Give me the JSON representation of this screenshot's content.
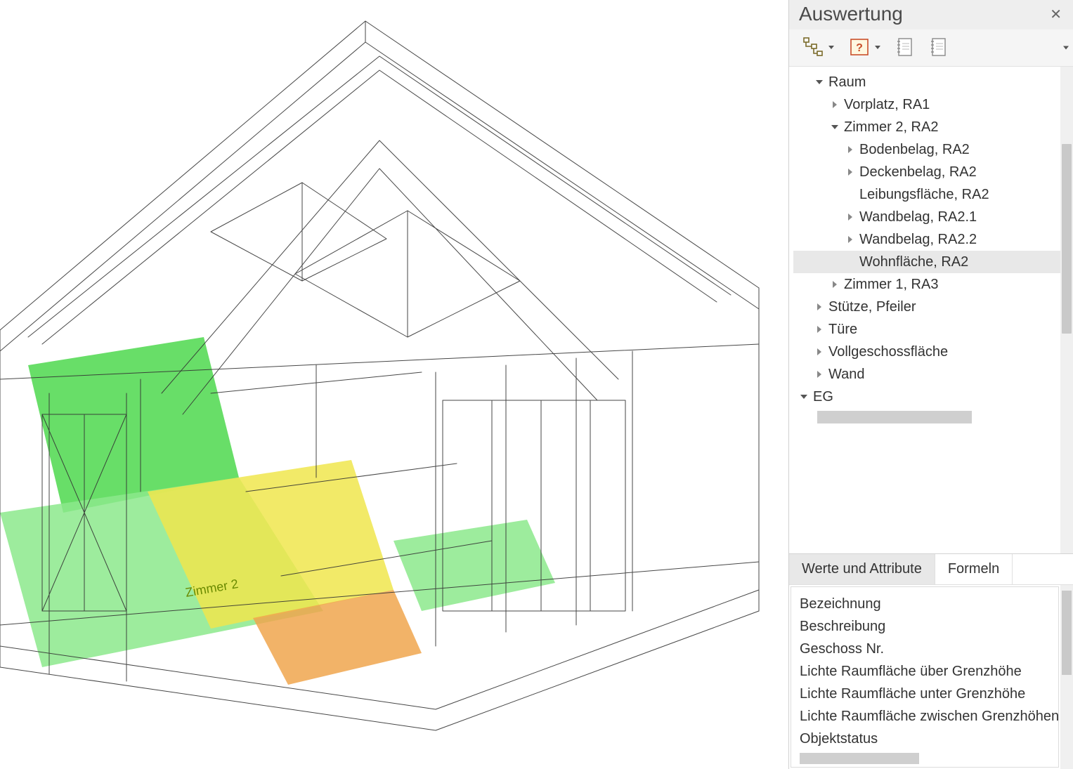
{
  "panel": {
    "title": "Auswertung",
    "tabs": {
      "values": "Werte und Attribute",
      "formulas": "Formeln"
    }
  },
  "toolbar": {
    "tree_icon": "tree-view-icon",
    "unknown_icon": "unknown-box-icon",
    "book1_icon": "notebook-icon",
    "book2_icon": "notebook-icon"
  },
  "tree": [
    {
      "indent": 1,
      "exp": "down",
      "label": "Raum"
    },
    {
      "indent": 2,
      "exp": "right",
      "label": "Vorplatz, RA1"
    },
    {
      "indent": 2,
      "exp": "down",
      "label": "Zimmer 2, RA2"
    },
    {
      "indent": 3,
      "exp": "right",
      "label": "Bodenbelag, RA2"
    },
    {
      "indent": 3,
      "exp": "right",
      "label": "Deckenbelag, RA2"
    },
    {
      "indent": 3,
      "exp": "none",
      "label": "Leibungsfläche, RA2"
    },
    {
      "indent": 3,
      "exp": "right",
      "label": "Wandbelag, RA2.1"
    },
    {
      "indent": 3,
      "exp": "right",
      "label": "Wandbelag, RA2.2"
    },
    {
      "indent": 3,
      "exp": "none",
      "label": "Wohnfläche, RA2",
      "selected": true
    },
    {
      "indent": 2,
      "exp": "right",
      "label": "Zimmer 1, RA3"
    },
    {
      "indent": 1,
      "exp": "right",
      "label": "Stütze, Pfeiler"
    },
    {
      "indent": 1,
      "exp": "right",
      "label": "Türe"
    },
    {
      "indent": 1,
      "exp": "right",
      "label": "Vollgeschossfläche"
    },
    {
      "indent": 1,
      "exp": "right",
      "label": "Wand"
    },
    {
      "indent": 0,
      "exp": "down",
      "label": "EG"
    }
  ],
  "attributes": [
    "Bezeichnung",
    "Beschreibung",
    "Geschoss Nr.",
    "Lichte Raumfläche über Grenzhöhe",
    "Lichte Raumfläche unter Grenzhöhe",
    "Lichte Raumfläche zwischen Grenzhöhen",
    "Objektstatus"
  ],
  "viewport": {
    "floor_label": "Zimmer 2",
    "floor_colors": {
      "green": "#4dd84d",
      "light_green": "#8ce98c",
      "yellow": "#f0e64d",
      "orange": "#f0a64d"
    }
  }
}
